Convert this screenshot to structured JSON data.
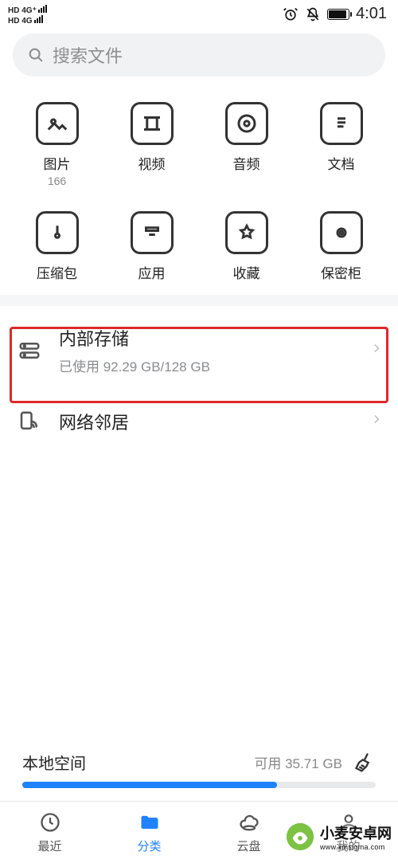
{
  "status": {
    "left_top": "HD",
    "left_4g": "4G⁺",
    "left_bottom": "HD",
    "left_4g2": "4G",
    "clock": "4:01"
  },
  "search": {
    "placeholder": "搜索文件"
  },
  "categories": [
    {
      "label": "图片",
      "count": "166"
    },
    {
      "label": "视频",
      "count": ""
    },
    {
      "label": "音频",
      "count": ""
    },
    {
      "label": "文档",
      "count": ""
    },
    {
      "label": "压缩包",
      "count": ""
    },
    {
      "label": "应用",
      "count": ""
    },
    {
      "label": "收藏",
      "count": ""
    },
    {
      "label": "保密柜",
      "count": ""
    }
  ],
  "storage": {
    "internal_title": "内部存储",
    "internal_sub": "已使用 92.29 GB/128 GB",
    "neighbor_title": "网络邻居"
  },
  "footer": {
    "left": "本地空间",
    "right": "可用 35.71 GB"
  },
  "nav": {
    "recent": "最近",
    "category": "分类",
    "cloud": "云盘",
    "me": "我的"
  },
  "watermark": {
    "name": "小麦安卓网",
    "url": "www.xmsigma.com"
  }
}
